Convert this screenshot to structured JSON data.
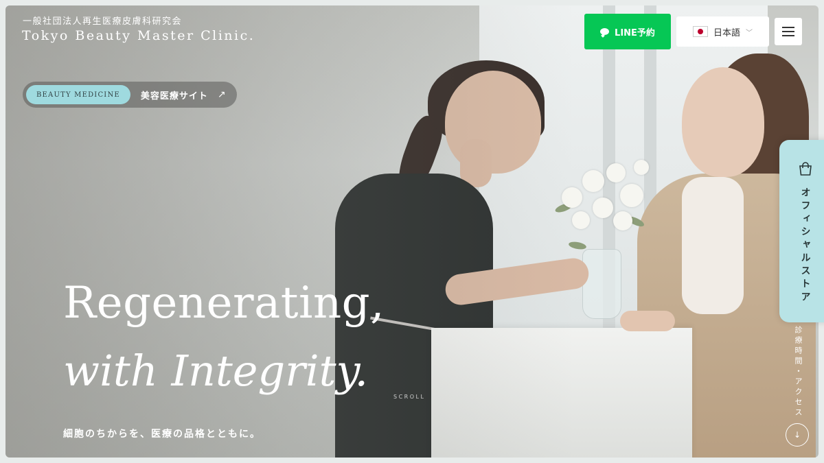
{
  "header": {
    "org_name": "一般社団法人再生医療皮膚科研究会",
    "clinic_name": "Tokyo Beauty Master Clinic."
  },
  "actions": {
    "line_label": "LINE予約",
    "line_icon": "line-chat-icon",
    "line_color": "#06c755",
    "language_label": "日本語",
    "language_flag": "japan-flag-icon",
    "menu_icon": "hamburger-menu-icon"
  },
  "beauty_link": {
    "tag": "BEAUTY MEDICINE",
    "label": "美容医療サイト",
    "arrow": "↗"
  },
  "hero": {
    "headline_line1": "Regenerating,",
    "headline_line2": "with Integrity.",
    "tagline": "細胞のちからを、医療の品格とともに。",
    "scroll_label": "SCROLL"
  },
  "side": {
    "store_label": "オフィシャルストア",
    "store_icon": "shopping-bag-icon",
    "store_color": "#b8e3e6",
    "access_label": "診療時間・アクセス",
    "down_arrow": "↓"
  }
}
